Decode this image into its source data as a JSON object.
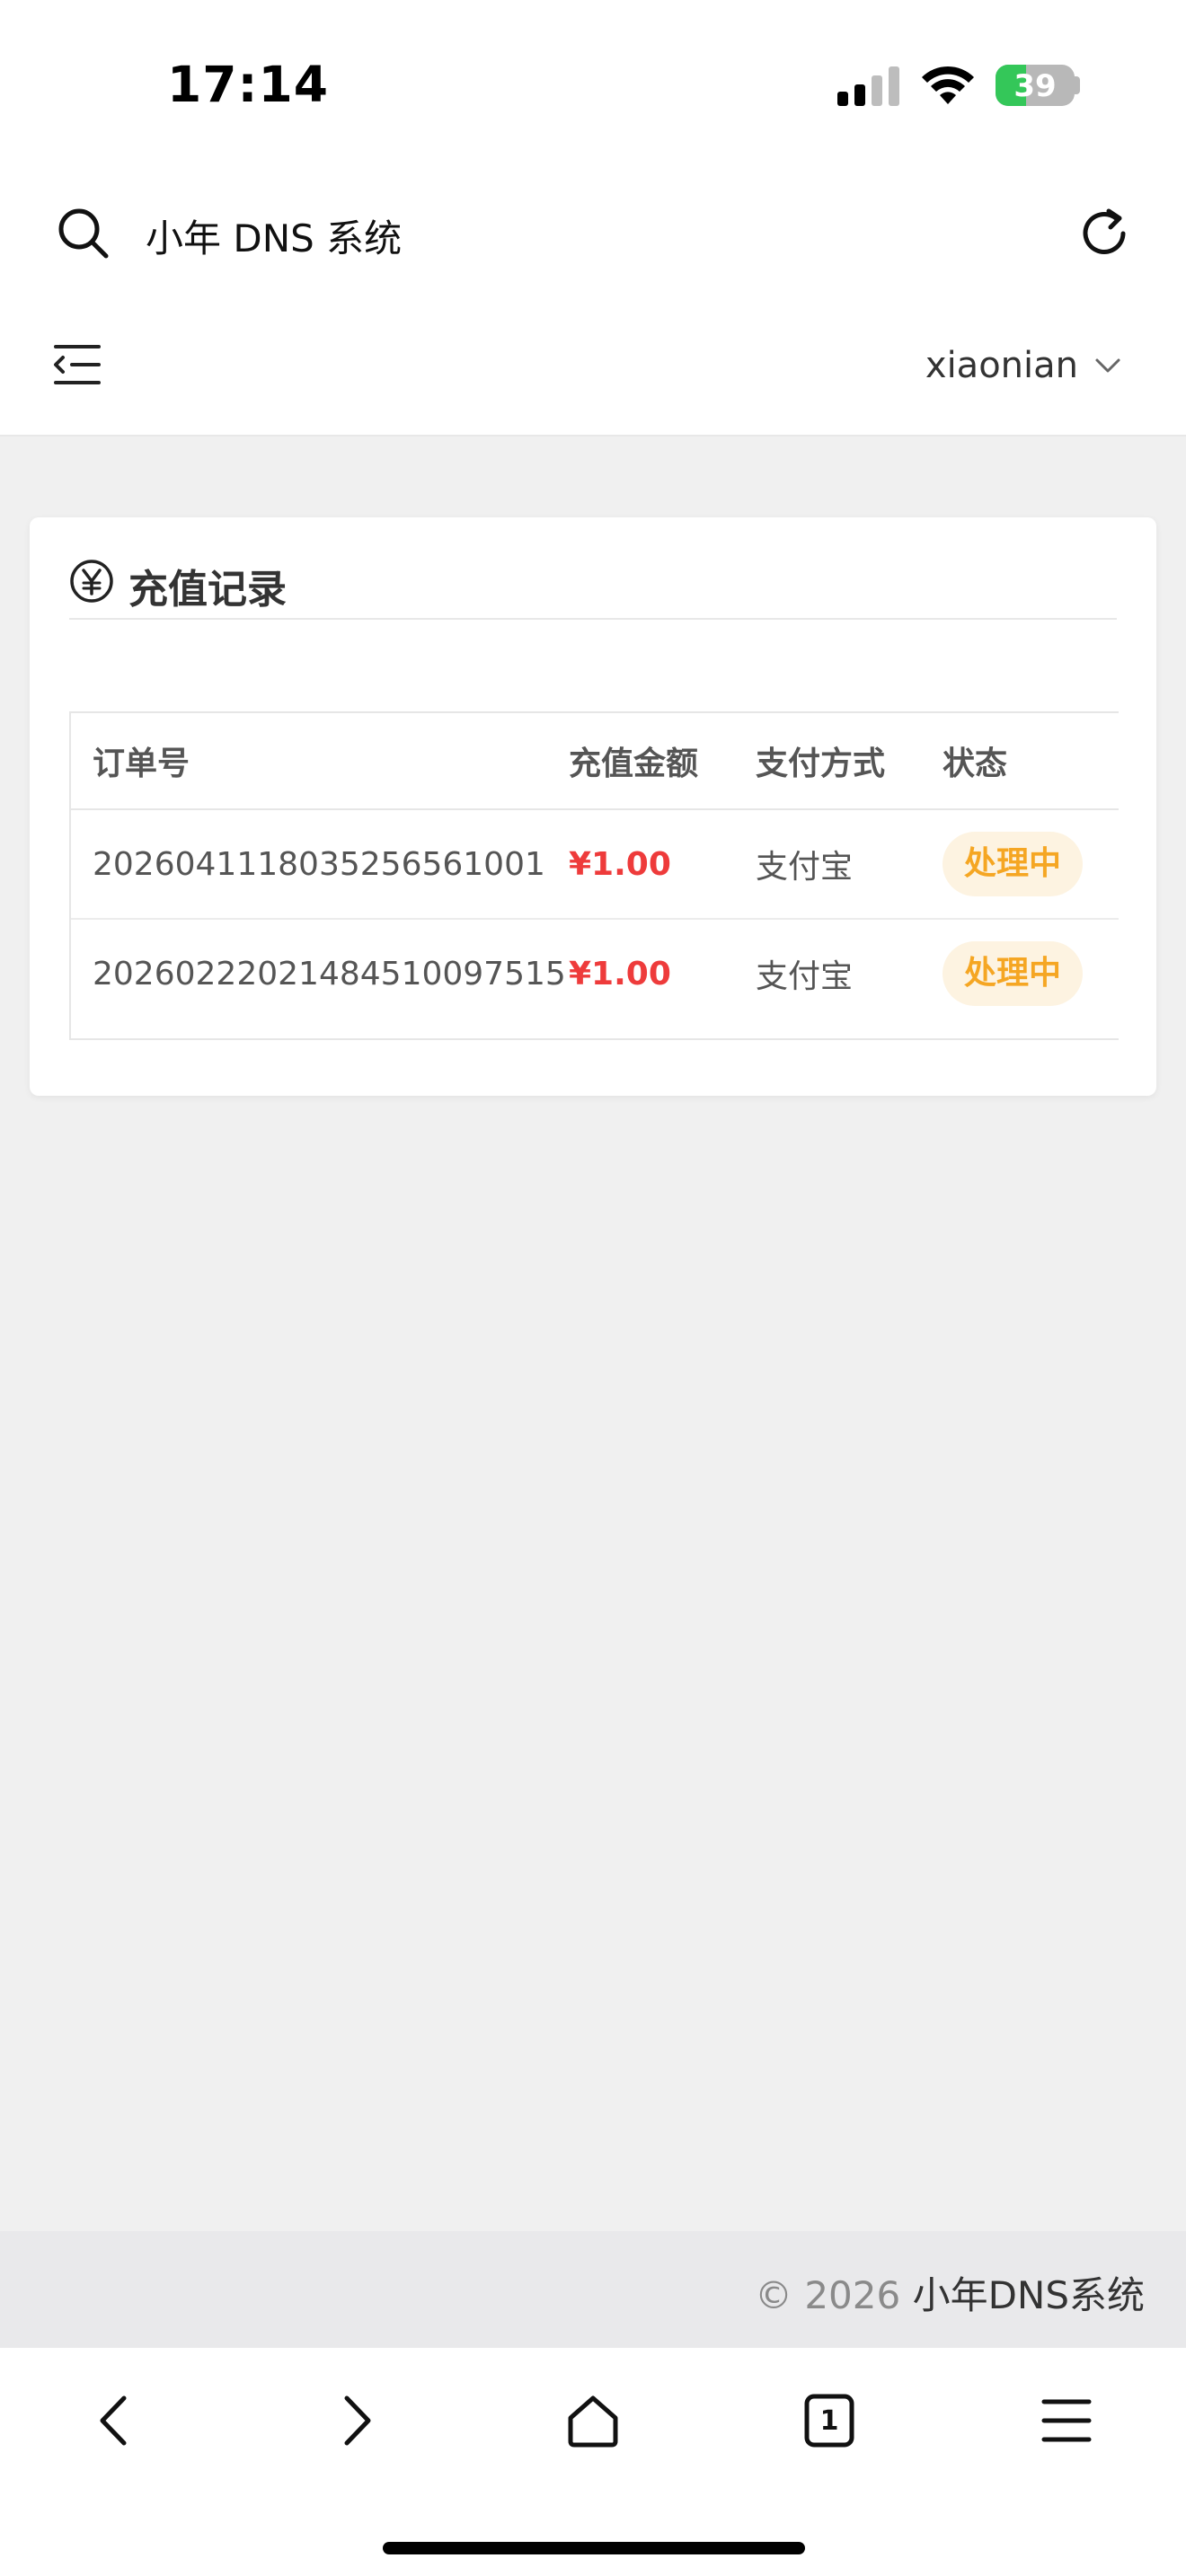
{
  "status_bar": {
    "time": "17:14",
    "battery_level": "39",
    "battery_fraction": 0.39
  },
  "browser": {
    "address": "小年 DNS 系统",
    "open_tabs": "1"
  },
  "header": {
    "username": "xiaonian"
  },
  "card": {
    "title": "充值记录",
    "columns": [
      "订单号",
      "充值金额",
      "支付方式",
      "状态"
    ],
    "rows": [
      {
        "order_no": "20260411180352565610​01",
        "amount": "¥1.00",
        "payment": "支付宝",
        "status": "处理中"
      },
      {
        "order_no": "20260222021484510097515",
        "amount": "¥1.00",
        "payment": "支付宝",
        "status": "处理中"
      }
    ]
  },
  "footer": {
    "copyright_symbol": "© 2026",
    "copyright_name": "小年DNS系统"
  },
  "colors": {
    "amount": "#ee3b3b",
    "status_badge_text": "#f5a623",
    "status_badge_bg": "#fdf3e1",
    "battery_fill": "#34c759"
  }
}
